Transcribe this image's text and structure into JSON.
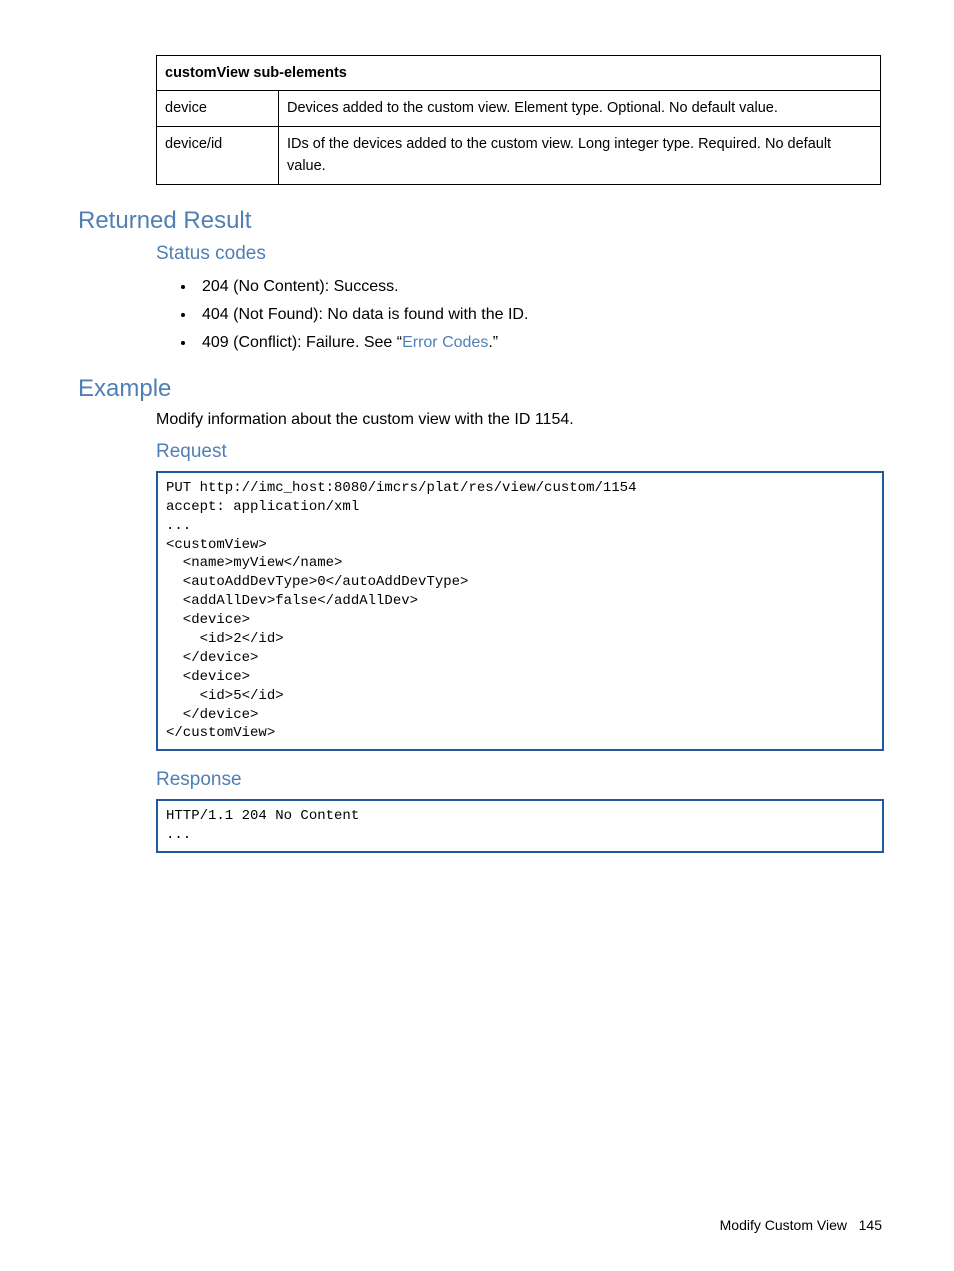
{
  "table": {
    "header": "customView sub-elements",
    "rows": [
      {
        "name": "device",
        "desc": "Devices added to the custom view.\nElement type. Optional. No default value."
      },
      {
        "name": "device/id",
        "desc": "IDs of the devices added to the custom view.\nLong integer type. Required. No default value."
      }
    ]
  },
  "sections": {
    "returned_result": "Returned Result",
    "status_codes_heading": "Status codes",
    "status_codes": [
      {
        "text": "204 (No Content): Success."
      },
      {
        "text": "404 (Not Found): No data is found with the ID."
      },
      {
        "prefix": "409 (Conflict): Failure. See “",
        "link": "Error Codes",
        "suffix": ".”"
      }
    ],
    "example_heading": "Example",
    "example_intro": "Modify information about the custom view with the ID 1154.",
    "request_heading": "Request",
    "request_code": "PUT http://imc_host:8080/imcrs/plat/res/view/custom/1154\naccept: application/xml\n...\n<customView>\n  <name>myView</name>\n  <autoAddDevType>0</autoAddDevType>\n  <addAllDev>false</addAllDev>\n  <device>\n    <id>2</id>\n  </device>\n  <device>\n    <id>5</id>\n  </device>\n</customView>",
    "response_heading": "Response",
    "response_code": "HTTP/1.1 204 No Content\n..."
  },
  "footer": {
    "title": "Modify Custom View",
    "page": "145"
  }
}
